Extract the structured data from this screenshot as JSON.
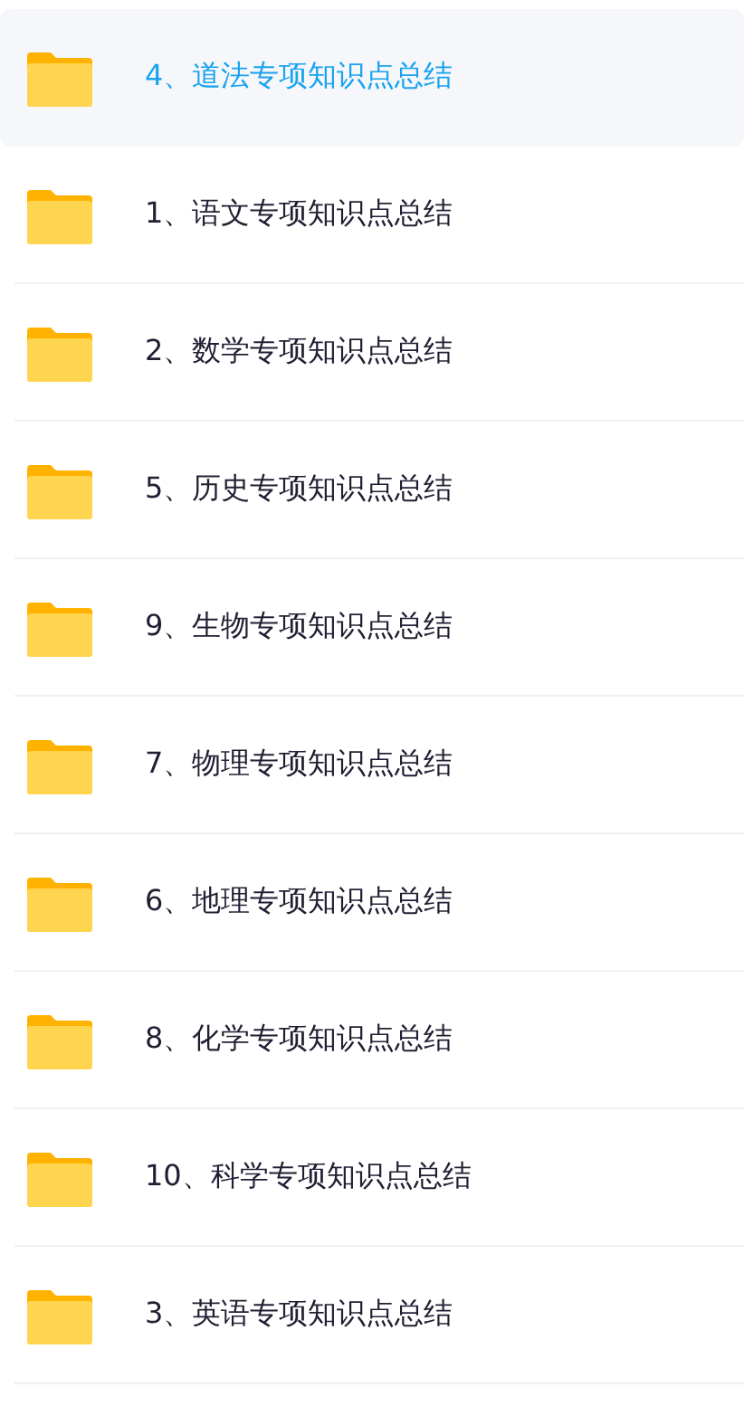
{
  "folders": [
    {
      "name": "4、道法专项知识点总结",
      "selected": true
    },
    {
      "name": "1、语文专项知识点总结",
      "selected": false
    },
    {
      "name": "2、数学专项知识点总结",
      "selected": false
    },
    {
      "name": "5、历史专项知识点总结",
      "selected": false
    },
    {
      "name": "9、生物专项知识点总结",
      "selected": false
    },
    {
      "name": "7、物理专项知识点总结",
      "selected": false
    },
    {
      "name": "6、地理专项知识点总结",
      "selected": false
    },
    {
      "name": "8、化学专项知识点总结",
      "selected": false
    },
    {
      "name": "10、科学专项知识点总结",
      "selected": false
    },
    {
      "name": "3、英语专项知识点总结",
      "selected": false
    }
  ]
}
